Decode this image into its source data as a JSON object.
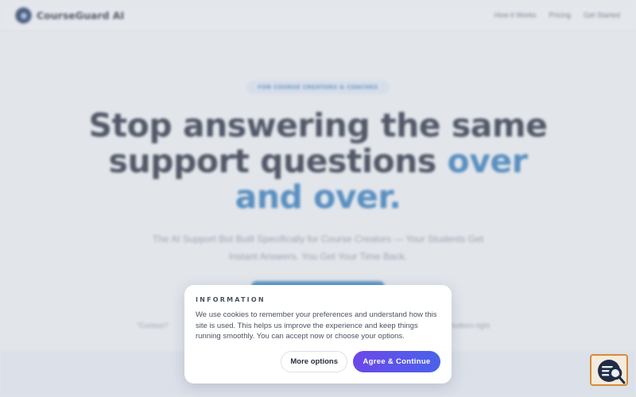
{
  "nav": {
    "brand": "CourseGuard AI",
    "links": [
      "How it Works",
      "Pricing",
      "Get Started"
    ]
  },
  "hero": {
    "badge": "FOR COURSE CREATORS & COACHES",
    "headline_line1": "Stop answering the same",
    "headline_line2_plain": "support questions ",
    "headline_line2_accent": "over",
    "headline_line3_accent": "and over.",
    "subtitle": "The AI Support Bot Built Specifically for Course Creators — Your Students Get Instant Answers. You Get Your Time Back.",
    "footnote_left": "\"Curious?",
    "footnote_right": "bottom-right"
  },
  "cookie": {
    "title": "INFORMATION",
    "text": "We use cookies to remember your preferences and understand how this site is used. This helps us improve the experience and keep things running smoothly. You can accept now or choose your options.",
    "more_label": "More options",
    "agree_label": "Agree & Continue"
  },
  "widget": {
    "icon": "chat-search-icon"
  },
  "colors": {
    "accent": "#2874b8",
    "agree_gradient_start": "#6b48e8",
    "agree_gradient_end": "#4a62ea",
    "widget_border": "#d88a36"
  }
}
